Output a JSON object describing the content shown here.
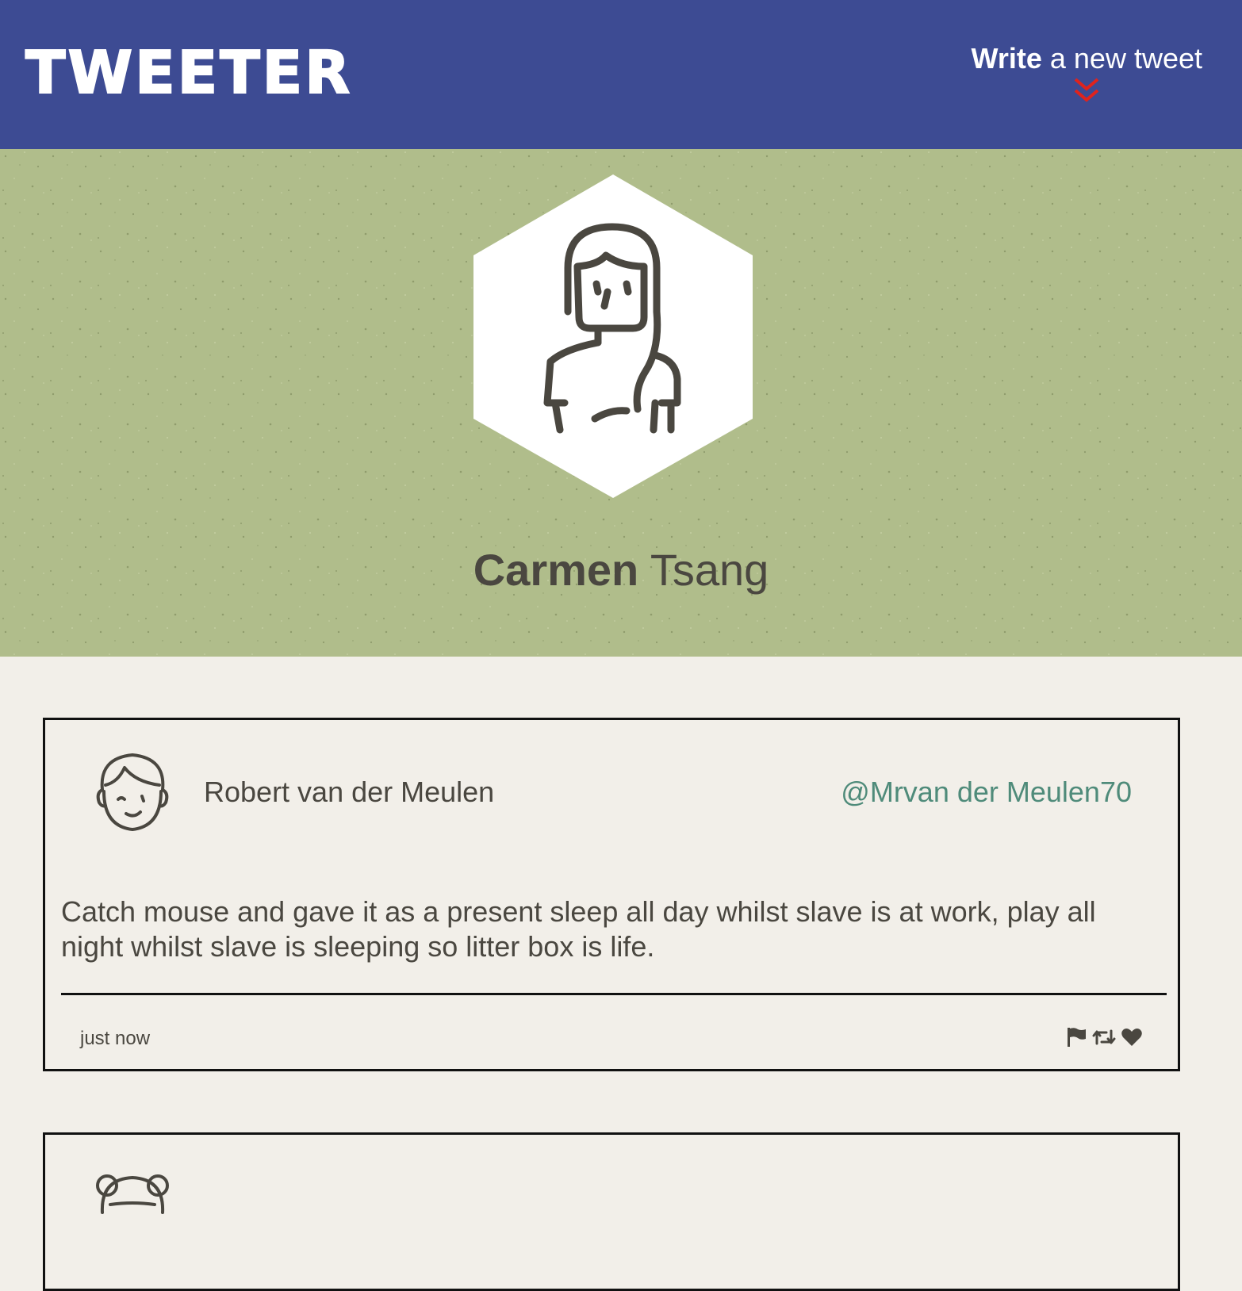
{
  "header": {
    "brand": "TWEETER",
    "compose_bold": "Write",
    "compose_rest": "a new tweet"
  },
  "profile": {
    "first_name": "Carmen",
    "last_name": "Tsang",
    "avatar_icon": "woman-avatar-icon"
  },
  "tweets": [
    {
      "author": "Robert van der Meulen",
      "handle": "@Mrvan der Meulen70",
      "body": "Catch mouse and gave it as a present sleep all day whilst slave is at work, play all night whilst slave is sleeping so litter box is life.",
      "time": "just now",
      "avatar_icon": "boy-avatar-icon",
      "actions": [
        "flag-icon",
        "retweet-icon",
        "heart-icon"
      ]
    },
    {
      "author": "",
      "handle": "",
      "avatar_icon": "girl-avatar-icon"
    }
  ],
  "colors": {
    "nav_bg": "#3d4b93",
    "banner_bg": "#b0bd8b",
    "page_bg": "#f2efe9",
    "handle": "#4f8b7a",
    "chevron": "#e0231d"
  }
}
